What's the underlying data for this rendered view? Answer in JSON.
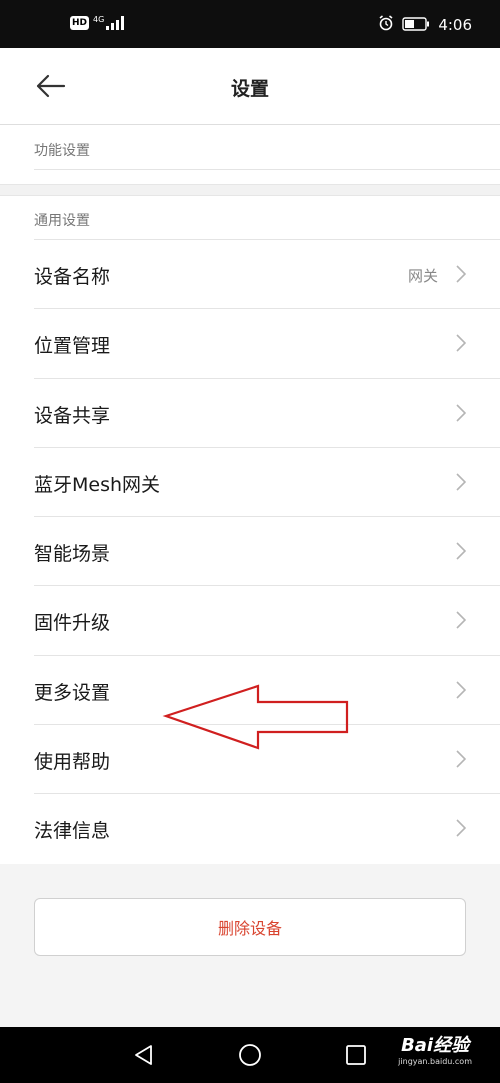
{
  "status_bar": {
    "hd_badge": "HD",
    "network": "4G",
    "time": "4:06",
    "icons": [
      "hd-icon",
      "signal-icon",
      "alarm-icon",
      "battery-icon"
    ]
  },
  "header": {
    "title": "设置",
    "back_icon": "back-arrow-icon"
  },
  "section_functions": {
    "label": "功能设置"
  },
  "section_general": {
    "label": "通用设置",
    "items": [
      {
        "label": "设备名称",
        "value": "网关"
      },
      {
        "label": "位置管理",
        "value": ""
      },
      {
        "label": "设备共享",
        "value": ""
      },
      {
        "label": "蓝牙Mesh网关",
        "value": ""
      },
      {
        "label": "智能场景",
        "value": ""
      },
      {
        "label": "固件升级",
        "value": ""
      },
      {
        "label": "更多设置",
        "value": ""
      },
      {
        "label": "使用帮助",
        "value": ""
      },
      {
        "label": "法律信息",
        "value": ""
      }
    ]
  },
  "delete_button": {
    "label": "删除设备",
    "color": "#d9442f"
  },
  "annotation": {
    "arrow_color": "#d01f1f",
    "points_to": "更多设置"
  },
  "nav_bar": {
    "icons": [
      "back-triangle-icon",
      "home-circle-icon",
      "recents-square-icon"
    ]
  },
  "watermark": {
    "brand": "Bai经验",
    "sub": "jingyan.baidu.com"
  }
}
